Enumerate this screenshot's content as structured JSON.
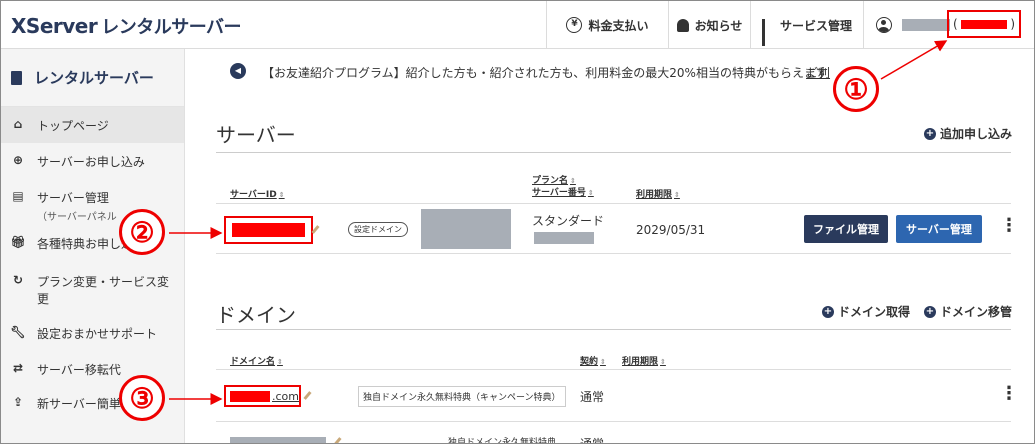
{
  "header": {
    "logo": "XServer",
    "logo_sub": "レンタルサーバー",
    "pay": "料金支払い",
    "pay_icon": "¥",
    "news": "お知らせ",
    "services": "サービス管理",
    "user_paren_open": "(",
    "user_paren_close": ")"
  },
  "sidebar": {
    "title": "レンタルサーバー",
    "items": [
      {
        "label": "トップページ",
        "icon": "home-icon"
      },
      {
        "label": "サーバーお申し込み",
        "icon": "plus-circle-icon"
      },
      {
        "label": "サーバー管理",
        "sub": "（サーバーパネル",
        "icon": "server-icon"
      },
      {
        "label": "各種特典お申し込",
        "icon": "gift-icon"
      },
      {
        "label": "プラン変更・サービス変",
        "label2": "更",
        "icon": "refresh-icon"
      },
      {
        "label": "設定おまかせサポート",
        "icon": "wrench-icon"
      },
      {
        "label": "サーバー移転代",
        "icon": "transfer-icon"
      },
      {
        "label": "新サーバー簡単移",
        "icon": "upload-icon"
      }
    ]
  },
  "notice": {
    "text": "【お友達紹介プログラム】紹介した方も・紹介された方も、利用料金の最大20%相当の特典がもらえます",
    "link": "ご利"
  },
  "server_section": {
    "title": "サーバー",
    "add_link": "追加申し込み",
    "col_server_id": "サーバーID",
    "col_plan_line1": "プラン名",
    "col_plan_line2": "サーバー番号",
    "col_expiry": "利用期限",
    "row": {
      "tag": "設定ドメイン",
      "plan": "スタンダード",
      "expiry": "2029/05/31",
      "file_btn": "ファイル管理",
      "server_btn": "サーバー管理"
    }
  },
  "domain_section": {
    "title": "ドメイン",
    "acquire_link": "ドメイン取得",
    "transfer_link": "ドメイン移管",
    "col_domain": "ドメイン名",
    "col_contract": "契約",
    "col_expiry": "利用期限",
    "rows": [
      {
        "suffix": ".com",
        "campaign": "独自ドメイン永久無料特典（キャンペーン特典）",
        "contract": "通常"
      },
      {
        "suffix": "",
        "campaign": "独自ドメイン永久無料特典",
        "contract": "通常"
      }
    ]
  },
  "annotations": [
    "①",
    "②",
    "③"
  ],
  "colors": {
    "navy": "#2a3a5c",
    "blue": "#2d66b0",
    "annotation_red": "#ee0000"
  }
}
